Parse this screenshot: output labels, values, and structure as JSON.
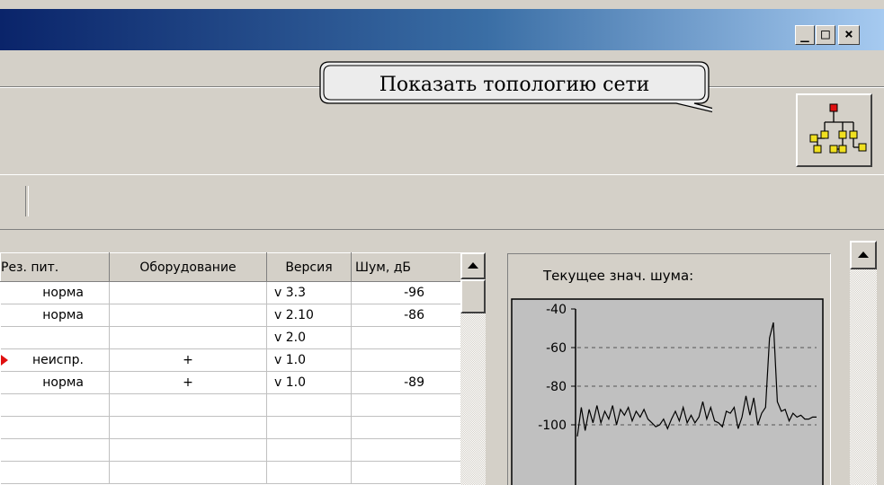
{
  "window": {
    "minimize_glyph": "_",
    "maximize_glyph": "□",
    "close_glyph": "×"
  },
  "toolbar": {
    "topology_tooltip": "Показать топологию сети",
    "topology_icon": "network-tree-icon"
  },
  "table": {
    "columns": [
      "Рез. пит.",
      "Оборудование",
      "Версия",
      "Шум, дБ"
    ],
    "rows": [
      [
        "норма",
        "",
        "v 3.3",
        "-96"
      ],
      [
        "норма",
        "",
        "v 2.10",
        "-86"
      ],
      [
        "",
        "",
        "v 2.0",
        ""
      ],
      [
        "неиспр.",
        "+",
        "v 1.0",
        ""
      ],
      [
        "норма",
        "+",
        "v 1.0",
        "-89"
      ],
      [
        "",
        "",
        "",
        ""
      ],
      [
        "",
        "",
        "",
        ""
      ],
      [
        "",
        "",
        "",
        ""
      ],
      [
        "",
        "",
        "",
        ""
      ]
    ],
    "fault_marker_row": 3,
    "fault_marker_color": "#e01010"
  },
  "chart_data": {
    "type": "line",
    "title": "Текущее знач. шума:",
    "xlabel": "",
    "ylabel": "",
    "ylim": [
      -115,
      -40
    ],
    "yticks": [
      -40,
      -60,
      -80,
      -100
    ],
    "grid": true,
    "plot_bg": "#c0c0c0",
    "series": [
      {
        "values": [
          -106,
          -91,
          -103,
          -92,
          -99,
          -90,
          -99,
          -93,
          -97,
          -90,
          -100,
          -92,
          -95,
          -91,
          -98,
          -93,
          -96,
          -92,
          -97,
          -99,
          -101,
          -100,
          -97,
          -102,
          -97,
          -93,
          -98,
          -91,
          -99,
          -95,
          -99,
          -96,
          -88,
          -97,
          -91,
          -98,
          -99,
          -101,
          -93,
          -94,
          -91,
          -102,
          -96,
          -85,
          -95,
          -86,
          -100,
          -94,
          -91,
          -55,
          -47,
          -88,
          -93,
          -92,
          -98,
          -94,
          -96,
          -95,
          -97,
          -97,
          -96,
          -96
        ]
      }
    ]
  }
}
